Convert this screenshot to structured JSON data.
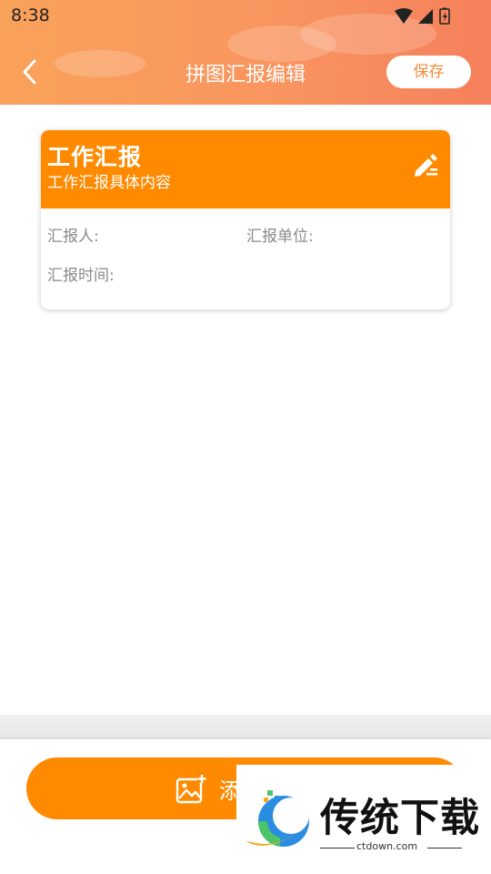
{
  "status_bar": {
    "time": "8:38"
  },
  "header": {
    "title": "拼图汇报编辑",
    "save_label": "保存",
    "back_icon": "chevron-left-icon"
  },
  "card": {
    "title": "工作汇报",
    "subtitle": "工作汇报具体内容",
    "reporter_label": "汇报人:",
    "unit_label": "汇报单位:",
    "time_label": "汇报时间:",
    "edit_icon": "pencil-icon"
  },
  "bottom": {
    "add_label": "添",
    "add_icon": "add-image-icon"
  },
  "watermark": {
    "brand": "传统下载",
    "url": "ctdown.com"
  },
  "colors": {
    "accent": "#ff8a00",
    "header_start": "#f9a25a",
    "header_end": "#f5805c",
    "label_gray": "#8a8a8a"
  }
}
